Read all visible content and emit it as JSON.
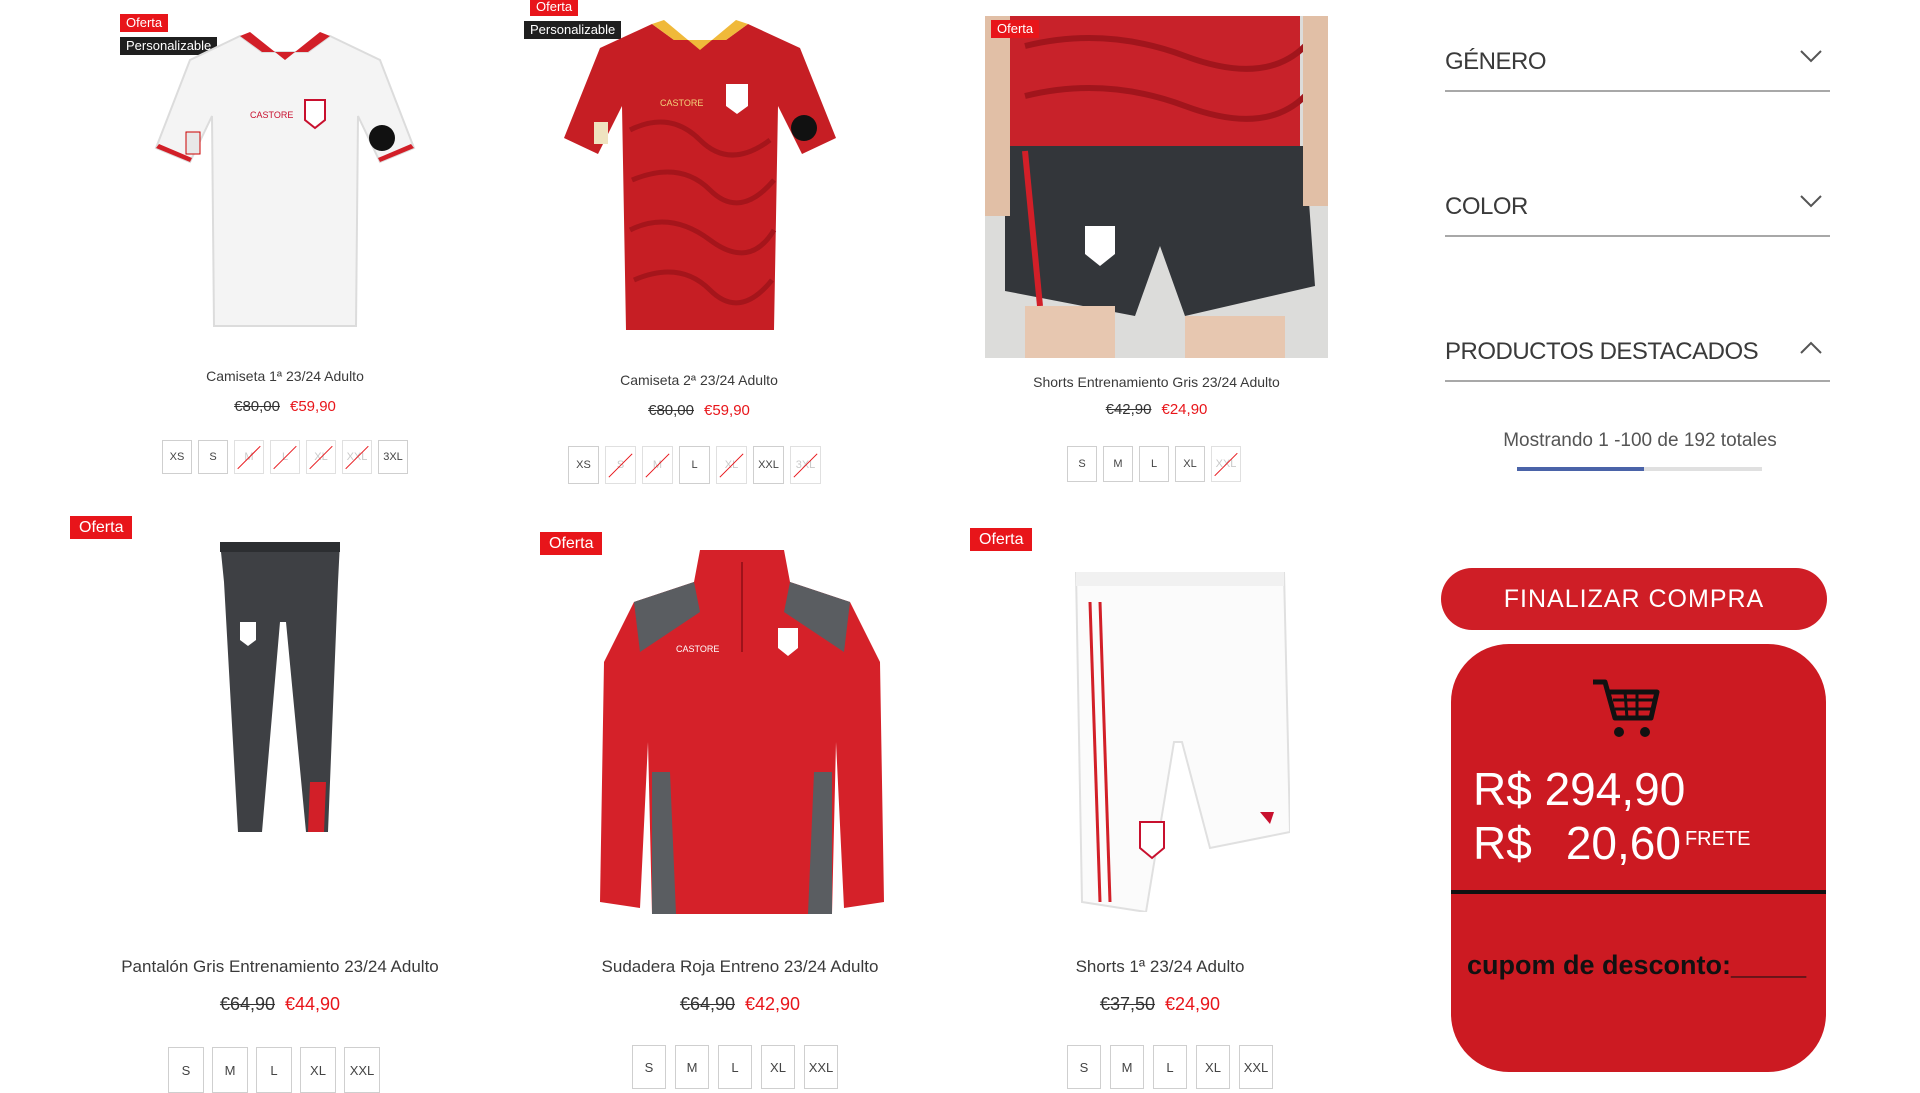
{
  "products": [
    {
      "name": "Camiseta 1ª 23/24 Adulto",
      "badges": [
        "Oferta",
        "Personalizable"
      ],
      "old_price": "€80,00",
      "new_price": "€59,90",
      "sizes": [
        {
          "label": "XS",
          "available": true
        },
        {
          "label": "S",
          "available": true
        },
        {
          "label": "M",
          "available": false
        },
        {
          "label": "L",
          "available": false
        },
        {
          "label": "XL",
          "available": false
        },
        {
          "label": "XXL",
          "available": false
        },
        {
          "label": "3XL",
          "available": true
        }
      ]
    },
    {
      "name": "Camiseta 2ª 23/24 Adulto",
      "badges": [
        "Oferta",
        "Personalizable"
      ],
      "old_price": "€80,00",
      "new_price": "€59,90",
      "sizes": [
        {
          "label": "XS",
          "available": true
        },
        {
          "label": "S",
          "available": false
        },
        {
          "label": "M",
          "available": false
        },
        {
          "label": "L",
          "available": true
        },
        {
          "label": "XL",
          "available": false
        },
        {
          "label": "XXL",
          "available": true
        },
        {
          "label": "3XL",
          "available": false
        }
      ]
    },
    {
      "name": "Shorts Entrenamiento Gris 23/24 Adulto",
      "badges": [
        "Oferta"
      ],
      "old_price": "€42,90",
      "new_price": "€24,90",
      "sizes": [
        {
          "label": "S",
          "available": true
        },
        {
          "label": "M",
          "available": true
        },
        {
          "label": "L",
          "available": true
        },
        {
          "label": "XL",
          "available": true
        },
        {
          "label": "XXL",
          "available": false
        }
      ]
    },
    {
      "name": "Pantalón Gris Entrenamiento 23/24 Adulto",
      "badges": [
        "Oferta"
      ],
      "old_price": "€64,90",
      "new_price": "€44,90",
      "sizes": [
        {
          "label": "S",
          "available": true
        },
        {
          "label": "M",
          "available": true
        },
        {
          "label": "L",
          "available": true
        },
        {
          "label": "XL",
          "available": true
        },
        {
          "label": "XXL",
          "available": true
        }
      ]
    },
    {
      "name": "Sudadera Roja Entreno 23/24 Adulto",
      "badges": [
        "Oferta"
      ],
      "old_price": "€64,90",
      "new_price": "€42,90",
      "sizes": [
        {
          "label": "S",
          "available": true
        },
        {
          "label": "M",
          "available": true
        },
        {
          "label": "L",
          "available": true
        },
        {
          "label": "XL",
          "available": true
        },
        {
          "label": "XXL",
          "available": true
        }
      ]
    },
    {
      "name": "Shorts 1ª 23/24 Adulto",
      "badges": [
        "Oferta"
      ],
      "old_price": "€37,50",
      "new_price": "€24,90",
      "sizes": [
        {
          "label": "S",
          "available": true
        },
        {
          "label": "M",
          "available": true
        },
        {
          "label": "L",
          "available": true
        },
        {
          "label": "XL",
          "available": true
        },
        {
          "label": "XXL",
          "available": true
        }
      ]
    }
  ],
  "filters": [
    {
      "label": "GÉNERO",
      "expanded": false
    },
    {
      "label": "COLOR",
      "expanded": false
    },
    {
      "label": "PRODUCTOS DESTACADOS",
      "expanded": true
    }
  ],
  "pagination": {
    "text": "Mostrando 1 -100 de 192 totales",
    "progress": 0.52
  },
  "checkout": {
    "button_label": "FINALIZAR COMPRA"
  },
  "cart": {
    "total": "R$ 294,90",
    "shipping_currency": "R$",
    "shipping_value": "20,60",
    "shipping_label": "FRETE",
    "coupon_label": "cupom de desconto:_____"
  },
  "colors": {
    "accent": "#e8151a",
    "cart_bg": "#cc1a22",
    "checkout_bg": "#cf1e26",
    "progress": "#4a63a8"
  },
  "icons": [
    "chevron-down-icon",
    "chevron-up-icon",
    "shopping-cart-icon"
  ]
}
